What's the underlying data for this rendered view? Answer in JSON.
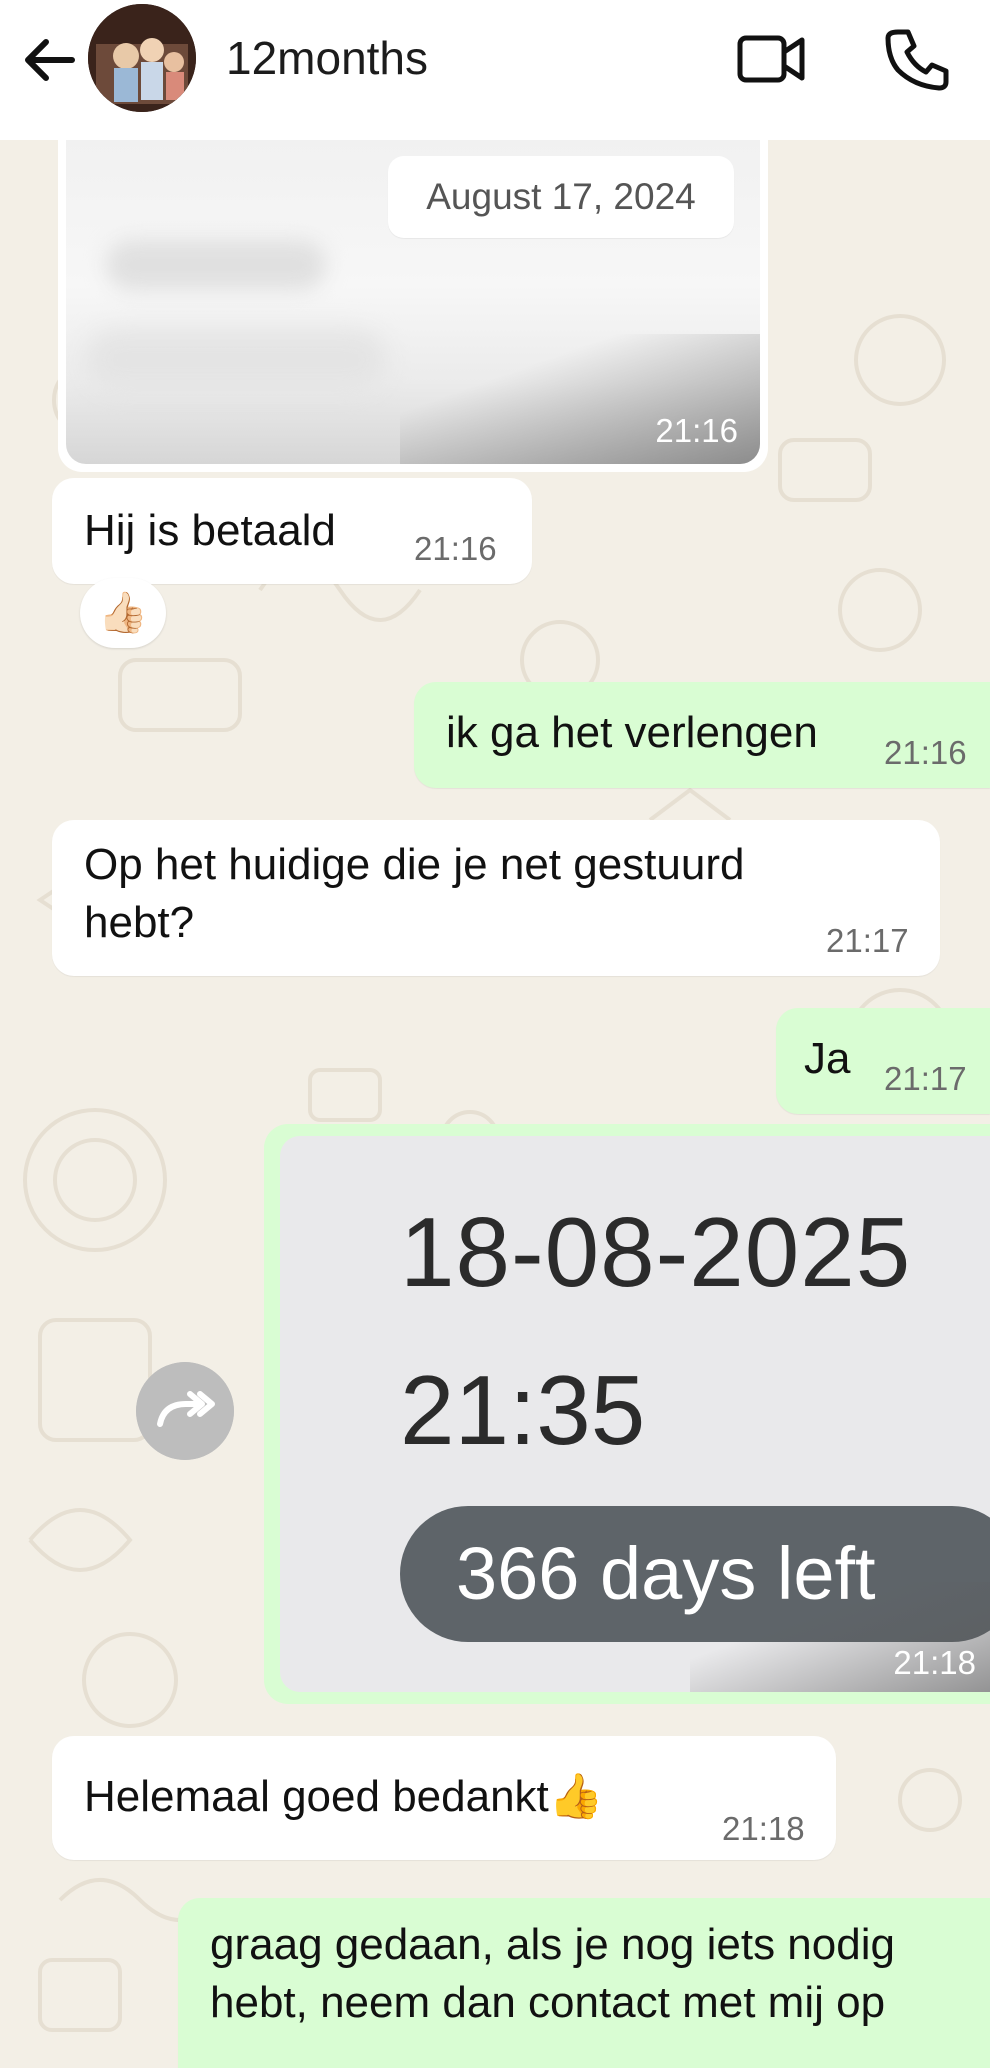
{
  "header": {
    "contact_name": "12months",
    "back_icon": "arrow-left-icon",
    "video_icon": "video-camera-icon",
    "call_icon": "phone-icon"
  },
  "date_chip": "August 17, 2024",
  "messages": [
    {
      "type": "image",
      "direction": "incoming",
      "time": "21:16"
    },
    {
      "type": "text",
      "direction": "incoming",
      "text": "Hij is betaald",
      "time": "21:16",
      "reaction": "👍🏻"
    },
    {
      "type": "text",
      "direction": "outgoing",
      "text": "ik ga het verlengen",
      "time": "21:16"
    },
    {
      "type": "text",
      "direction": "incoming",
      "lines": [
        "Op het huidige die je net gestuurd",
        "hebt?"
      ],
      "time": "21:17"
    },
    {
      "type": "text",
      "direction": "outgoing",
      "text": "Ja",
      "time": "21:17"
    },
    {
      "type": "image",
      "direction": "outgoing",
      "time": "21:18",
      "screenshot": {
        "date": "18-08-2025",
        "clock": "21:35",
        "pill": "366 days left"
      }
    },
    {
      "type": "text",
      "direction": "incoming",
      "text": "Helemaal goed bedankt👍",
      "time": "21:18"
    },
    {
      "type": "text",
      "direction": "outgoing",
      "lines": [
        "graag gedaan, als je nog iets nodig",
        "hebt, neem dan contact met mij op"
      ]
    }
  ],
  "colors": {
    "incoming_bubble": "#ffffff",
    "outgoing_bubble": "#d9fdd3",
    "wallpaper": "#f3efe6",
    "pill": "#5e6469"
  }
}
